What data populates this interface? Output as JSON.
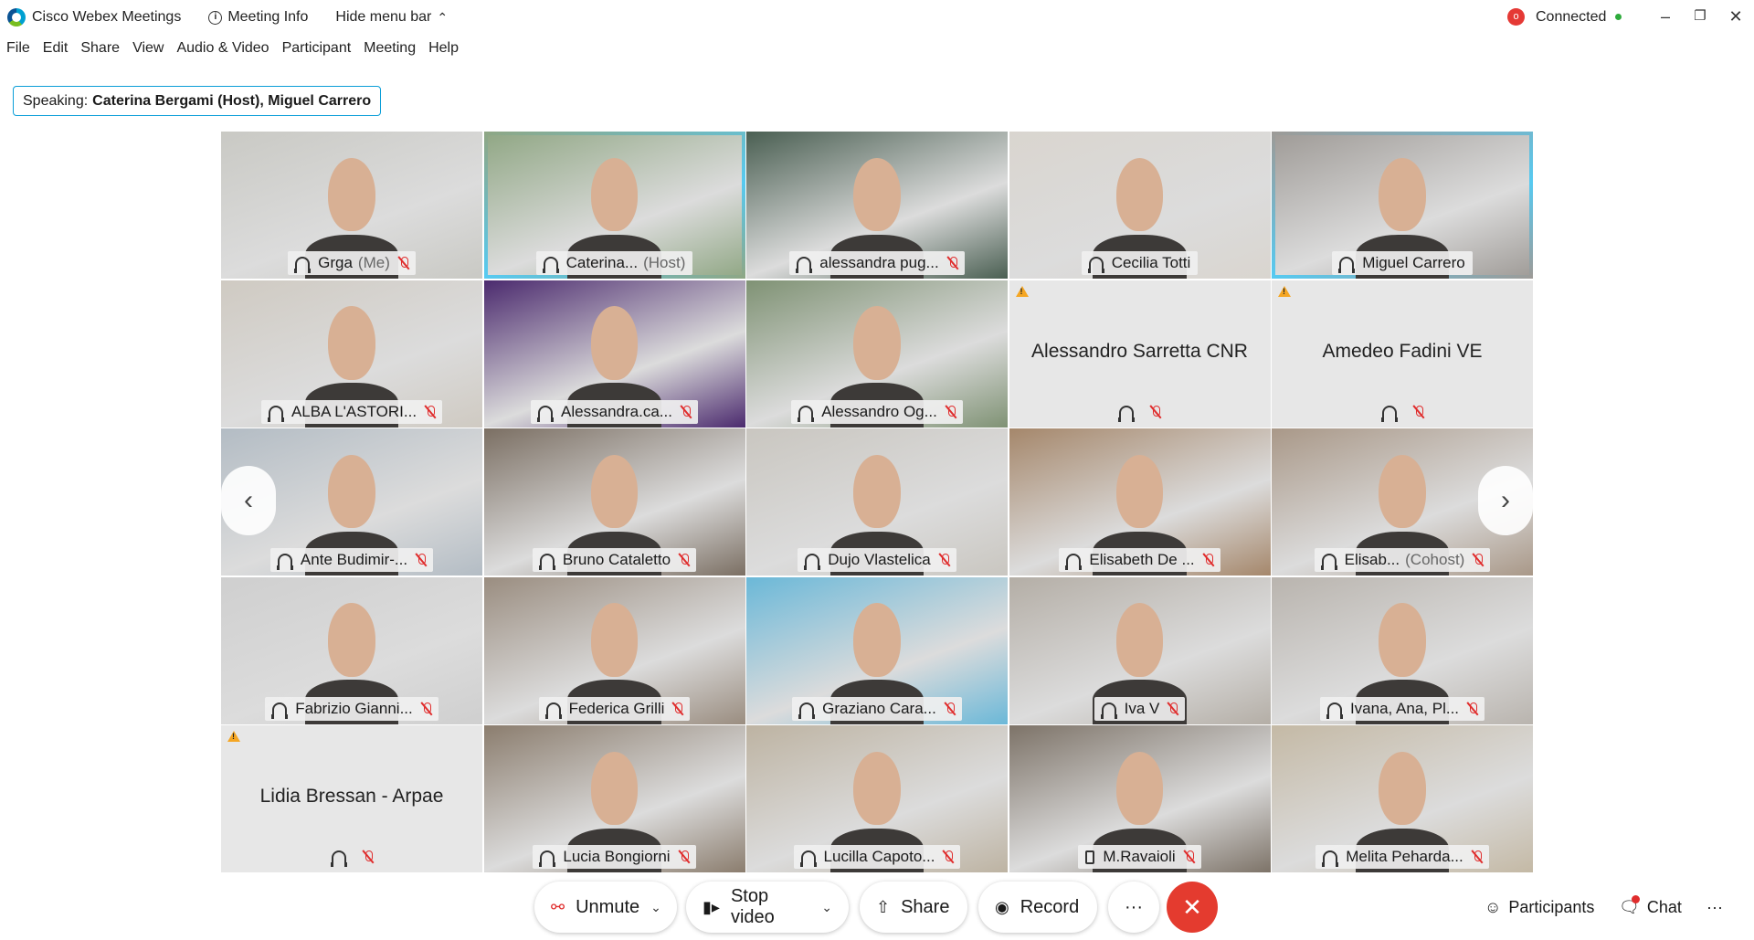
{
  "app": {
    "title": "Cisco Webex Meetings",
    "meeting_info": "Meeting Info",
    "hide_menu": "Hide menu bar",
    "status": "Connected"
  },
  "menu": [
    "File",
    "Edit",
    "Share",
    "View",
    "Audio & Video",
    "Participant",
    "Meeting",
    "Help"
  ],
  "speaking": {
    "prefix": "Speaking:",
    "names": "Caterina Bergami (Host), Miguel Carrero"
  },
  "tiles": [
    {
      "name": "Grga",
      "suffix": "(Me)",
      "icon": "headphones-icon",
      "muted": true,
      "video": true,
      "bg": "#c9c9c4"
    },
    {
      "name": "Caterina...",
      "suffix": "(Host)",
      "icon": "headphones-icon",
      "muted": false,
      "video": true,
      "active": true,
      "bg": "#8fa683"
    },
    {
      "name": "alessandra pug...",
      "suffix": "",
      "icon": "headphones-icon",
      "muted": true,
      "video": true,
      "bg": "#4a5f52"
    },
    {
      "name": "Cecilia Totti",
      "suffix": "",
      "icon": "headphones-icon",
      "muted": false,
      "video": true,
      "bg": "#d9d5cf"
    },
    {
      "name": "Miguel Carrero",
      "suffix": "",
      "icon": "headphones-icon",
      "muted": false,
      "video": true,
      "active": true,
      "bg": "#9e9a96"
    },
    {
      "name": "ALBA L'ASTORI...",
      "suffix": "",
      "icon": "headphones-icon",
      "muted": true,
      "video": true,
      "bg": "#cfcac2"
    },
    {
      "name": "Alessandra.ca...",
      "suffix": "",
      "icon": "headphones-icon",
      "muted": true,
      "video": true,
      "bg": "#4b2a6e"
    },
    {
      "name": "Alessandro Og...",
      "suffix": "",
      "icon": "headphones-icon",
      "muted": true,
      "video": true,
      "bg": "#7f9274"
    },
    {
      "name": "Alessandro Sarretta CNR",
      "suffix": "",
      "icon": "headphones-icon",
      "muted": true,
      "video": false,
      "warn": true
    },
    {
      "name": "Amedeo Fadini VE",
      "suffix": "",
      "icon": "headphones-icon",
      "muted": true,
      "video": false,
      "warn": true
    },
    {
      "name": "Ante Budimir-...",
      "suffix": "",
      "icon": "headphones-icon",
      "muted": true,
      "video": true,
      "bg": "#b3bcc4"
    },
    {
      "name": "Bruno Cataletto",
      "suffix": "",
      "icon": "headphones-icon",
      "muted": true,
      "video": true,
      "bg": "#7b6f63"
    },
    {
      "name": "Dujo Vlastelica",
      "suffix": "",
      "icon": "headphones-icon",
      "muted": true,
      "video": true,
      "bg": "#c9c6c0"
    },
    {
      "name": "Elisabeth De ...",
      "suffix": "",
      "icon": "headphones-icon",
      "muted": true,
      "video": true,
      "bg": "#a5876b"
    },
    {
      "name": "Elisab...",
      "suffix": "(Cohost)",
      "icon": "headphones-icon",
      "muted": true,
      "video": true,
      "bg": "#a99888"
    },
    {
      "name": "Fabrizio Gianni...",
      "suffix": "",
      "icon": "headphones-icon",
      "muted": true,
      "video": true,
      "bg": "#cfcfcf"
    },
    {
      "name": "Federica Grilli",
      "suffix": "",
      "icon": "headphones-icon",
      "muted": true,
      "video": true,
      "bg": "#9a8d80"
    },
    {
      "name": "Graziano Cara...",
      "suffix": "",
      "icon": "headphones-icon",
      "muted": true,
      "video": true,
      "bg": "#6bb8d8"
    },
    {
      "name": "Iva V",
      "suffix": "",
      "icon": "headphones-icon",
      "muted": true,
      "video": true,
      "bg": "#b4aea6"
    },
    {
      "name": "Ivana, Ana, Pl...",
      "suffix": "",
      "icon": "headphones-icon",
      "muted": true,
      "video": true,
      "bg": "#b9b4ae"
    },
    {
      "name": "Lidia Bressan - Arpae",
      "suffix": "",
      "icon": "headphones-icon",
      "muted": true,
      "video": false,
      "warn": true
    },
    {
      "name": "Lucia Bongiorni",
      "suffix": "",
      "icon": "headphones-icon",
      "muted": true,
      "video": true,
      "bg": "#8b7d6e"
    },
    {
      "name": "Lucilla Capoto...",
      "suffix": "",
      "icon": "headphones-icon",
      "muted": true,
      "video": true,
      "bg": "#bdb3a2"
    },
    {
      "name": "M.Ravaioli",
      "suffix": "",
      "icon": "phone-icon",
      "muted": true,
      "video": true,
      "bg": "#7d7368"
    },
    {
      "name": "Melita Peharda...",
      "suffix": "",
      "icon": "headphones-icon",
      "muted": true,
      "video": true,
      "bg": "#c4b9a5"
    }
  ],
  "controls": {
    "unmute": "Unmute",
    "stop_video": "Stop video",
    "share": "Share",
    "record": "Record",
    "more": "···"
  },
  "right_controls": {
    "participants": "Participants",
    "chat": "Chat",
    "more": "···"
  },
  "colors": {
    "accent": "#1eb8ec",
    "end_meeting": "#e43b2f",
    "muted": "#e02d2d",
    "connected": "#2eab3c",
    "warning": "#f5a623"
  }
}
